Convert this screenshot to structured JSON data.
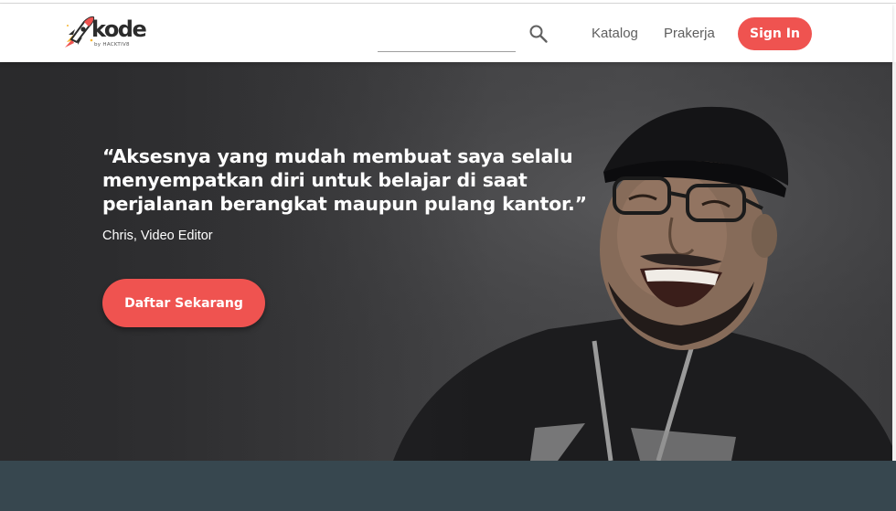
{
  "header": {
    "logo": {
      "name": "kode",
      "tagline": "by HACKTIV8"
    },
    "search": {
      "value": "",
      "placeholder": ""
    },
    "nav": [
      {
        "label": "Katalog"
      },
      {
        "label": "Prakerja"
      }
    ],
    "signin_label": "Sign In"
  },
  "hero": {
    "quote_lines": [
      "“Aksesnya yang mudah membuat saya selalu",
      "menyempatkan diri untuk belajar di saat",
      "perjalanan berangkat maupun pulang kantor.”"
    ],
    "attribution": "Chris, Video Editor",
    "cta_label": "Daftar Sekarang"
  },
  "colors": {
    "accent": "#ef5350",
    "hero_background": "#3e3e40",
    "bottom_band": "#37474f",
    "nav_text": "#5e5e5e"
  },
  "icons": {
    "logo": "rocket-icon",
    "search": "search-icon"
  }
}
